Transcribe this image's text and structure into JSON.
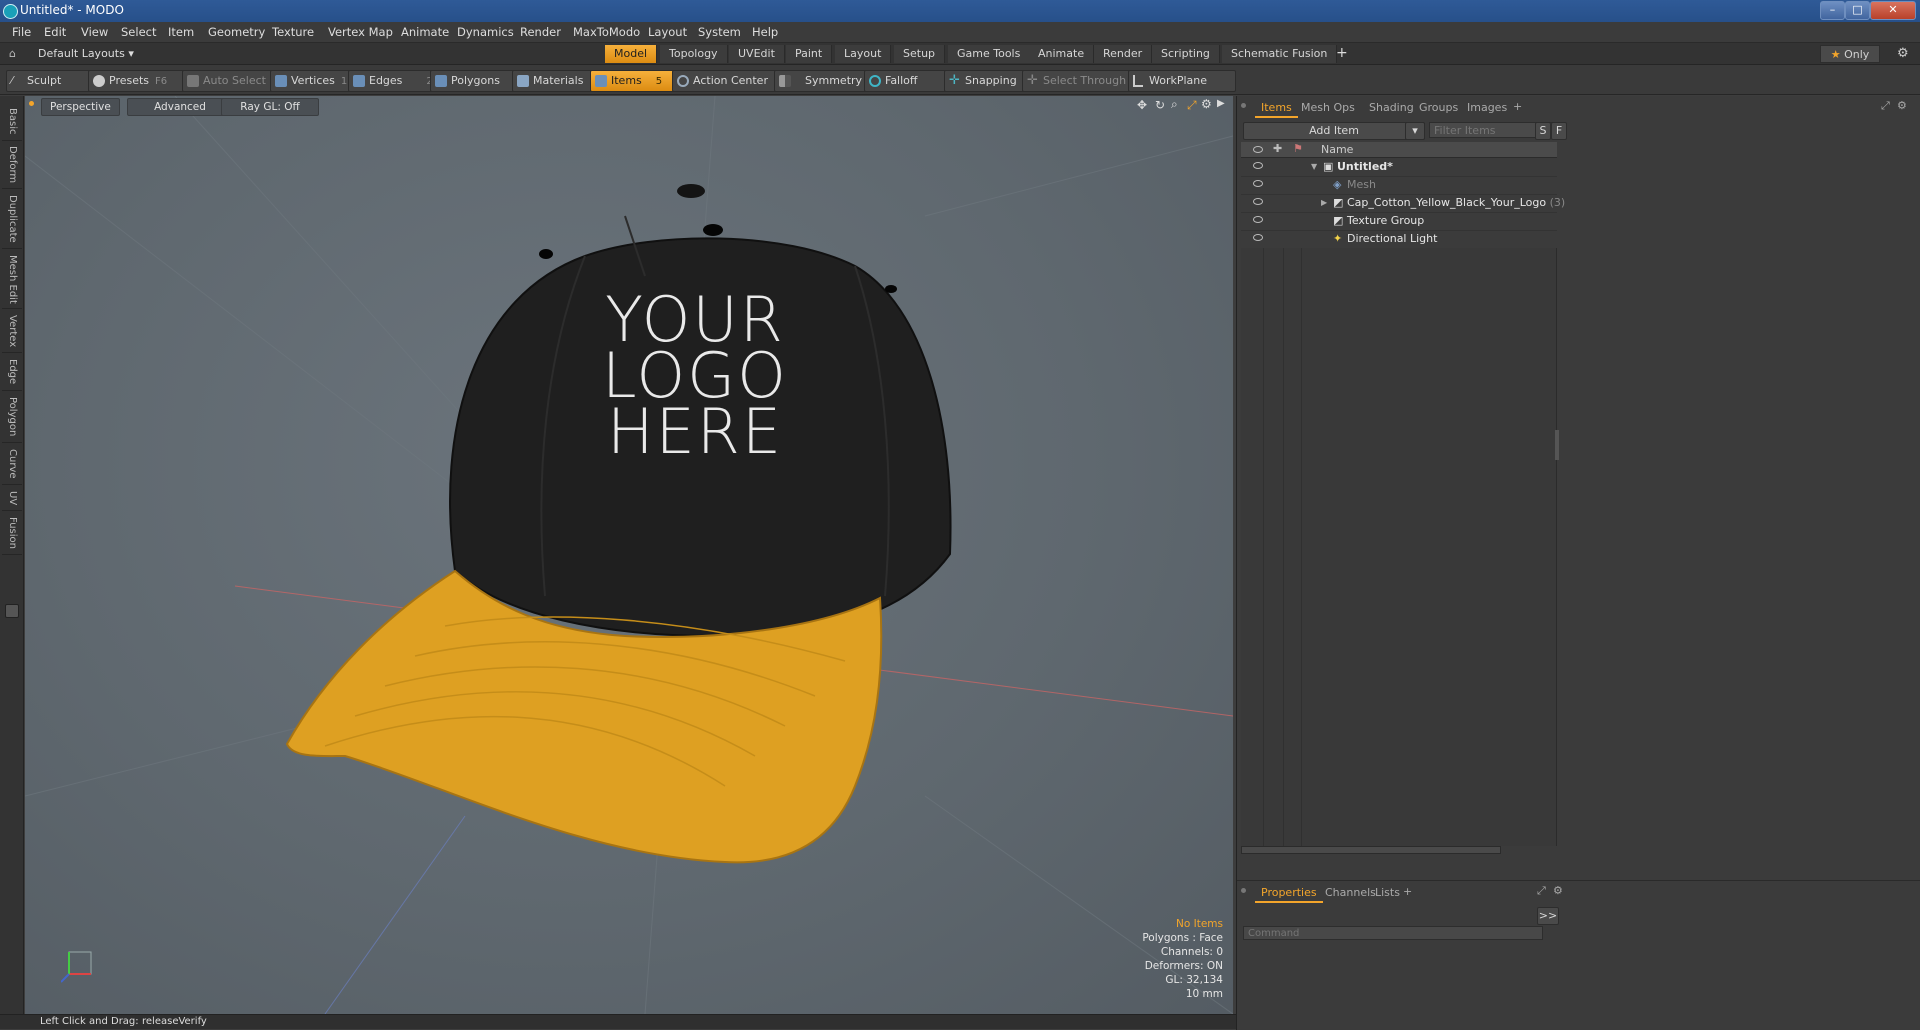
{
  "window": {
    "title": "Untitled* - MODO"
  },
  "menu": [
    "File",
    "Edit",
    "View",
    "Select",
    "Item",
    "Geometry",
    "Texture",
    "Vertex Map",
    "Animate",
    "Dynamics",
    "Render",
    "MaxToModo",
    "Layout",
    "System",
    "Help"
  ],
  "layout_bar": {
    "layouts_label": "Default Layouts",
    "tabs": [
      "Model",
      "Topology",
      "UVEdit",
      "Paint",
      "Layout",
      "Setup",
      "Game Tools",
      "Animate",
      "Render",
      "Scripting",
      "Schematic Fusion"
    ],
    "active_tab": "Model",
    "add_symbol": "+",
    "only_label": "Only",
    "star": "★"
  },
  "toolbar": {
    "sculpt": "Sculpt",
    "presets": "Presets",
    "presets_key": "F6",
    "auto_select": "Auto Select",
    "vertices": "Vertices",
    "vertices_key": "1",
    "edges": "Edges",
    "edges_key": "2",
    "polygons": "Polygons",
    "materials": "Materials",
    "items": "Items",
    "items_key": "5",
    "action_center": "Action Center",
    "symmetry": "Symmetry",
    "falloff": "Falloff",
    "snapping": "Snapping",
    "select_through": "Select Through",
    "workplane": "WorkPlane"
  },
  "left_tabs": [
    "Basic",
    "Deform",
    "Duplicate",
    "Mesh Edit",
    "Vertex",
    "Edge",
    "Polygon",
    "Curve",
    "UV",
    "Fusion"
  ],
  "viewport": {
    "perspective": "Perspective",
    "advanced": "Advanced",
    "raygl": "Ray GL: Off",
    "logo_lines": [
      "YOUR",
      "LOGO",
      "HERE"
    ],
    "info": {
      "selection": "No Items",
      "polygons": "Polygons : Face",
      "channels": "Channels: 0",
      "deformers": "Deformers: ON",
      "gl": "GL: 32,134",
      "units": "10 mm"
    }
  },
  "status_bar": {
    "left_hint": "Left Click and Drag:",
    "action": "releaseVerify"
  },
  "items_panel": {
    "tabs": [
      "Items",
      "Mesh Ops",
      "Shading",
      "Groups",
      "Images"
    ],
    "active_tab": "Items",
    "add_item": "Add Item",
    "filter_placeholder": "Filter Items",
    "s_btn": "S",
    "f_btn": "F",
    "column_name": "Name",
    "tree": [
      {
        "label": "Untitled*",
        "indent": 0,
        "bold": true
      },
      {
        "label": "Mesh",
        "indent": 1,
        "dim": true
      },
      {
        "label": "Cap_Cotton_Yellow_Black_Your_Logo",
        "count": "(3)",
        "indent": 1
      },
      {
        "label": "Texture Group",
        "indent": 1
      },
      {
        "label": "Directional Light",
        "indent": 1
      }
    ]
  },
  "properties_panel": {
    "tabs": [
      "Properties",
      "Channels",
      "Lists"
    ],
    "active_tab": "Properties",
    "command_placeholder": "Command",
    "expand": ">>"
  },
  "colors": {
    "accent": "#f3a52b",
    "cap_body": "#1f1f1f",
    "cap_brim": "#e0a224"
  }
}
